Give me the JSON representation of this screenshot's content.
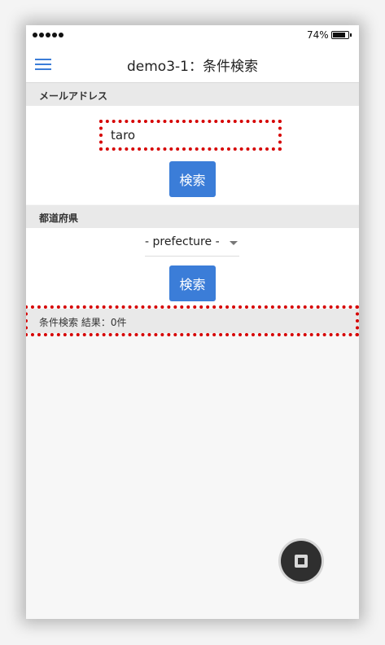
{
  "status_bar": {
    "battery_percent": "74%",
    "signal_bars": 5
  },
  "nav": {
    "title": "demo3-1：条件検索",
    "menu_icon": "hamburger-menu-icon"
  },
  "email_section": {
    "header": "メールアドレス",
    "input_value": "taro",
    "search_button": "検索"
  },
  "prefecture_section": {
    "header": "都道府県",
    "select_value": "- prefecture -",
    "search_button": "検索"
  },
  "result": {
    "text": "条件検索 結果：0件"
  },
  "fab": {
    "icon": "stop-square-icon"
  },
  "colors": {
    "accent": "#3b7dd8",
    "highlight_border": "#d60000",
    "section_bg": "#e9e9e9"
  }
}
